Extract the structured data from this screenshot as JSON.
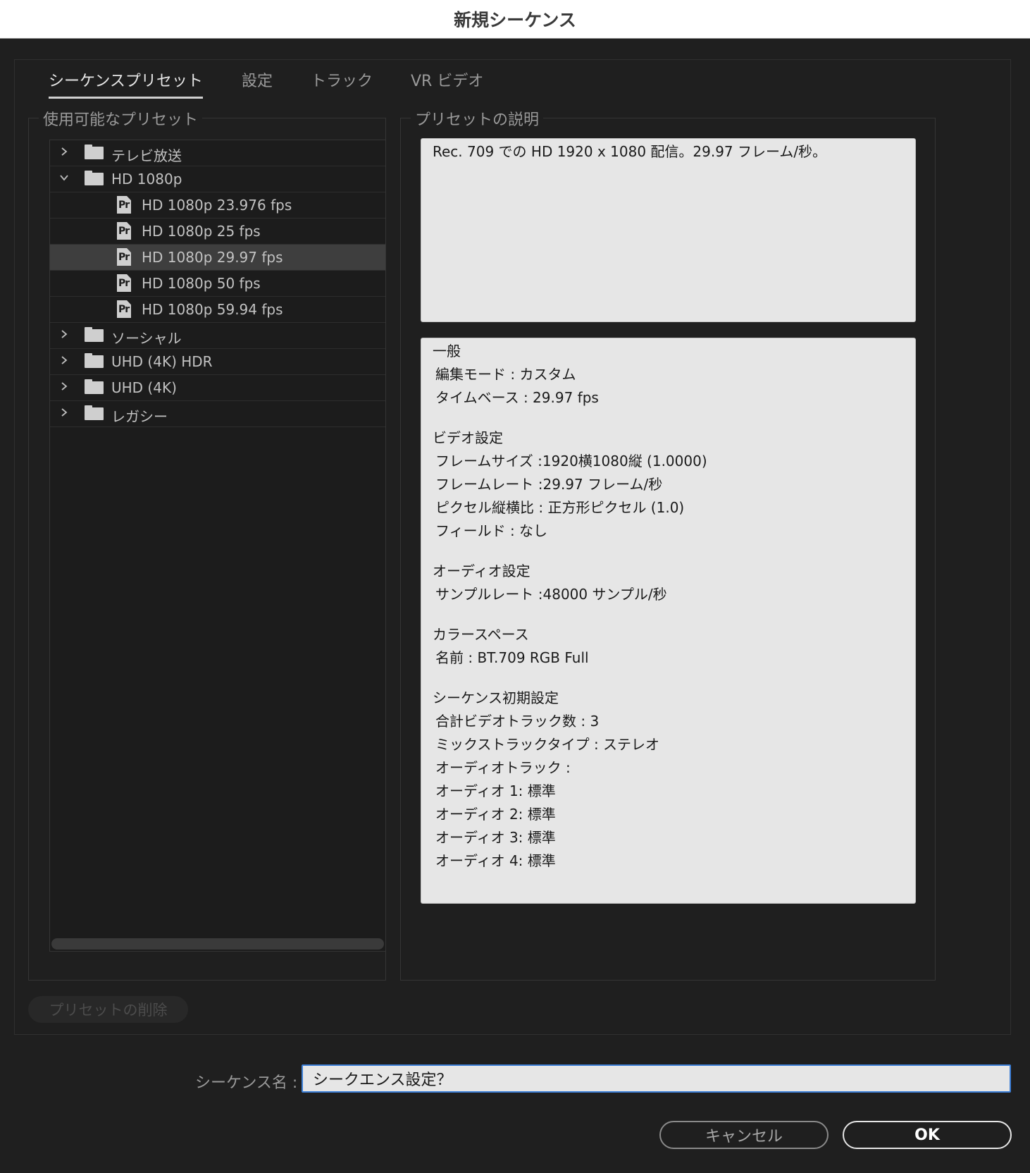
{
  "window": {
    "title": "新規シーケンス"
  },
  "tabs": [
    {
      "label": "シーケンスプリセット",
      "active": true
    },
    {
      "label": "設定",
      "active": false
    },
    {
      "label": "トラック",
      "active": false
    },
    {
      "label": "VR ビデオ",
      "active": false
    }
  ],
  "presets": {
    "legend": "使用可能なプリセット",
    "tree": [
      {
        "label": "テレビ放送",
        "type": "folder",
        "expanded": false
      },
      {
        "label": "HD 1080p",
        "type": "folder",
        "expanded": true
      },
      {
        "label": "HD 1080p 23.976 fps",
        "type": "preset"
      },
      {
        "label": "HD 1080p 25 fps",
        "type": "preset"
      },
      {
        "label": "HD 1080p 29.97 fps",
        "type": "preset",
        "selected": true
      },
      {
        "label": "HD 1080p 50 fps",
        "type": "preset"
      },
      {
        "label": "HD 1080p 59.94 fps",
        "type": "preset"
      },
      {
        "label": "ソーシャル",
        "type": "folder",
        "expanded": false
      },
      {
        "label": "UHD (4K) HDR",
        "type": "folder",
        "expanded": false
      },
      {
        "label": "UHD (4K)",
        "type": "folder",
        "expanded": false
      },
      {
        "label": "レガシー",
        "type": "folder",
        "expanded": false
      }
    ],
    "icon_text": "Pr",
    "delete_button": "プリセットの削除"
  },
  "description": {
    "legend": "プリセットの説明",
    "text": "Rec. 709 での HD 1920 x 1080 配信。29.97 フレーム/秒。"
  },
  "settings": {
    "sections": [
      {
        "heading": "一般",
        "lines": [
          "編集モード : カスタム",
          "タイムベース : 29.97 fps"
        ]
      },
      {
        "heading": "ビデオ設定",
        "lines": [
          "フレームサイズ :1920横1080縦 (1.0000)",
          "フレームレート :29.97  フレーム/秒",
          "ピクセル縦横比 : 正方形ピクセル (1.0)",
          "フィールド : なし"
        ]
      },
      {
        "heading": "オーディオ設定",
        "lines": [
          "サンプルレート :48000 サンプル/秒"
        ]
      },
      {
        "heading": "カラースペース",
        "lines": [
          "名前 : BT.709 RGB Full"
        ]
      },
      {
        "heading": "シーケンス初期設定",
        "lines": [
          "合計ビデオトラック数 : 3",
          "ミックストラックタイプ : ステレオ",
          "オーディオトラック :",
          "オーディオ 1: 標準",
          "オーディオ 2: 標準",
          "オーディオ 3: 標準",
          "オーディオ 4: 標準"
        ]
      }
    ]
  },
  "sequence_name": {
    "label": "シーケンス名 :",
    "value": "シークエンス設定？"
  },
  "buttons": {
    "cancel": "キャンセル",
    "ok": "OK"
  },
  "colors": {
    "input_focus": "#3d7fd6",
    "selected_row": "#3e3e3e",
    "background": "#1f1f1f"
  }
}
